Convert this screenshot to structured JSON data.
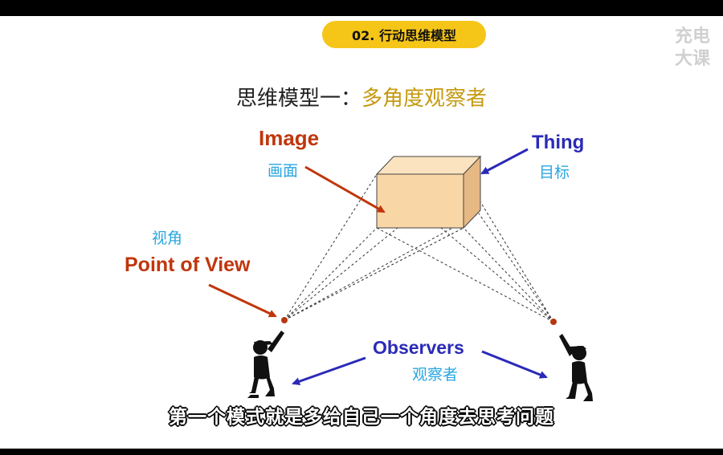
{
  "badge": "02. 行动思维模型",
  "watermark": {
    "line1": "充电",
    "line2": "大课"
  },
  "title": {
    "prefix": "思维模型一：",
    "highlight": "多角度观察者"
  },
  "diagram": {
    "image": {
      "en": "Image",
      "zh": "画面"
    },
    "thing": {
      "en": "Thing",
      "zh": "目标"
    },
    "point_of_view": {
      "zh": "视角",
      "en": "Point of View"
    },
    "observers": {
      "en": "Observers",
      "zh": "观察者"
    },
    "colors": {
      "red": "#c0360b",
      "blue": "#2a2ab8",
      "cyan": "#2aa7e0",
      "box": "#f9d9a8"
    }
  },
  "subtitle": "第一个模式就是多给自己一个角度去思考问题"
}
